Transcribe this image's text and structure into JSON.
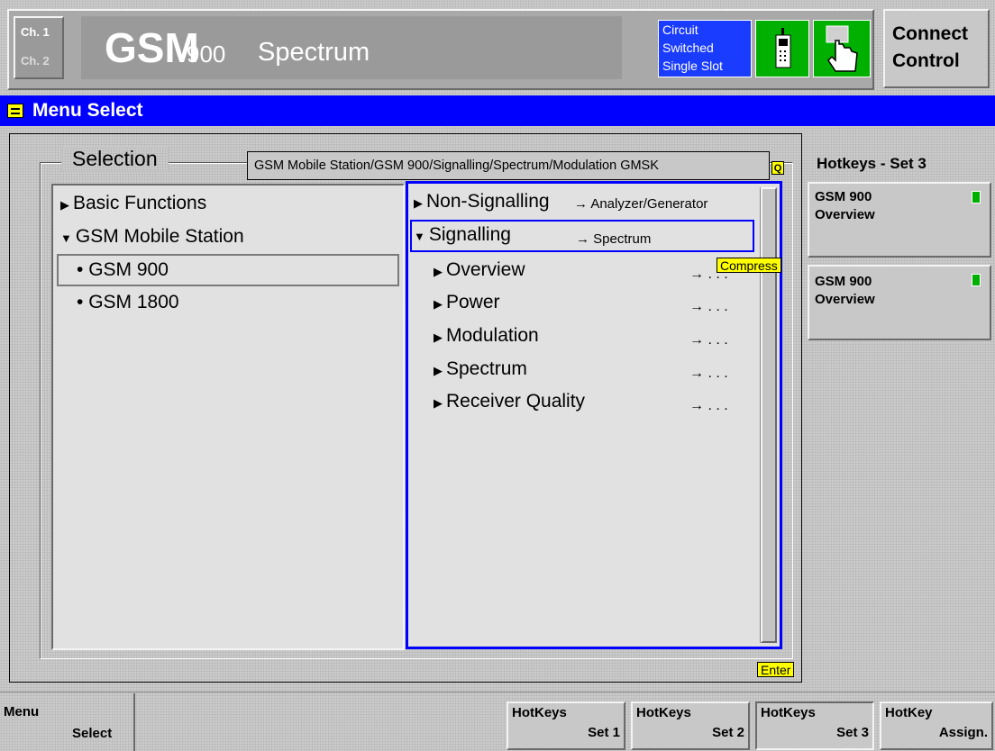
{
  "header": {
    "ch1": "Ch. 1",
    "ch2": "Ch. 2",
    "title_main": "GSM",
    "title_band": "900",
    "title_mode": "Spectrum",
    "connection_line1": "Circuit",
    "connection_line2": "Switched",
    "connection_line3": "Single Slot",
    "connect_control_line1": "Connect",
    "connect_control_line2": "Control"
  },
  "menu_bar": {
    "title": "Menu Select"
  },
  "selection": {
    "label": "Selection",
    "path": "GSM Mobile Station/GSM 900/Signalling/Spectrum/Modulation GMSK",
    "left_tree": [
      "Basic Functions",
      "GSM Mobile Station",
      "GSM 900",
      "GSM 1800"
    ],
    "right_tree": {
      "non_signalling": "Non-Signalling",
      "non_signalling_target": "→ Analyzer/Generator",
      "signalling": "Signalling",
      "signalling_target": "→ Spectrum",
      "items": [
        "Overview",
        "Power",
        "Modulation",
        "Spectrum",
        "Receiver Quality"
      ],
      "item_target": "→ . . ."
    },
    "compress_label": "Compress",
    "enter_label": "Enter",
    "q_label": "Q"
  },
  "hotkeys": {
    "title": "Hotkeys - Set 3",
    "buttons": [
      {
        "line1": "GSM 900",
        "line2": "Overview"
      },
      {
        "line1": "GSM 900",
        "line2": "Overview"
      }
    ]
  },
  "softkeys": {
    "menu_select_line1": "Menu",
    "menu_select_line2": "Select",
    "items": [
      {
        "line1": "HotKeys",
        "line2": "Set 1"
      },
      {
        "line1": "HotKeys",
        "line2": "Set 2"
      },
      {
        "line1": "HotKeys",
        "line2": "Set 3"
      },
      {
        "line1": "HotKey",
        "line2": "Assign."
      }
    ]
  },
  "colors": {
    "menu_bar": "#0000ff",
    "highlight_border": "#0000ff",
    "badge_yellow": "#ffff00",
    "phone_icon_green": "#00b000",
    "connection_bg": "#0033ff"
  }
}
